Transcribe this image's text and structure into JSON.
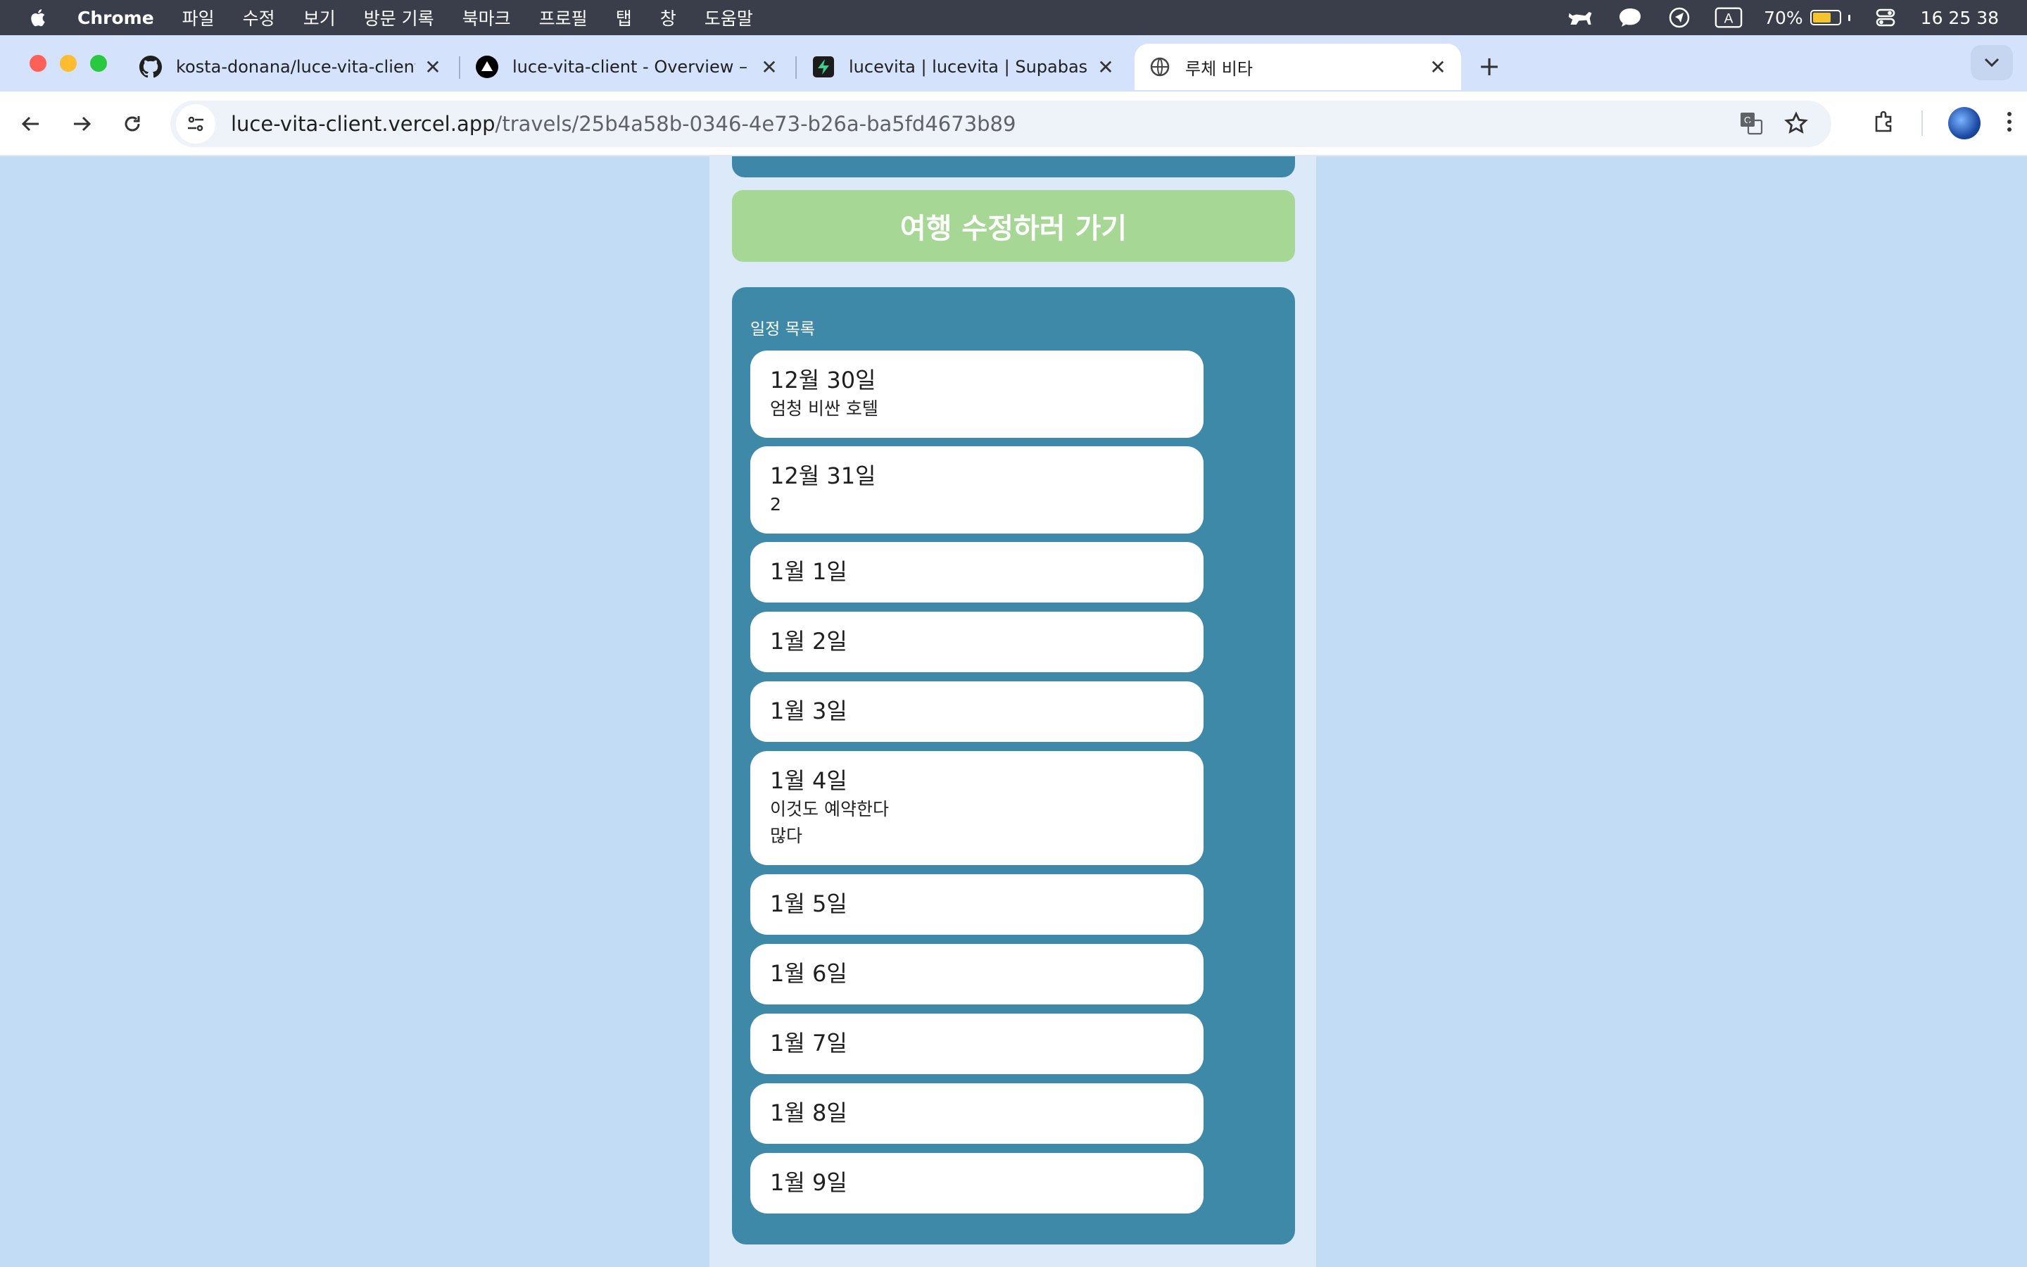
{
  "menubar": {
    "app_name": "Chrome",
    "items": [
      "파일",
      "수정",
      "보기",
      "방문 기록",
      "북마크",
      "프로필",
      "탭",
      "창",
      "도움말"
    ],
    "battery_percent": "70%",
    "time": "16 25 38"
  },
  "tabs": [
    {
      "title": "kosta-donana/luce-vita-client",
      "icon": "github-icon",
      "active": false
    },
    {
      "title": "luce-vita-client - Overview – ",
      "icon": "vercel-icon",
      "active": false
    },
    {
      "title": "lucevita | lucevita | Supabase",
      "icon": "supabase-icon",
      "active": false
    },
    {
      "title": "루체 비타",
      "icon": "globe-icon",
      "active": true
    }
  ],
  "address_bar": {
    "host": "luce-vita-client.vercel.app",
    "path": "/travels/25b4a58b-0346-4e73-b26a-ba5fd4673b89"
  },
  "page": {
    "edit_button_label": "여행 수정하러 가기",
    "schedule_title": "일정 목록",
    "days": [
      {
        "date": "12월 30일",
        "notes": [
          "엄청 비싼 호텔"
        ]
      },
      {
        "date": "12월 31일",
        "notes": [
          "2"
        ]
      },
      {
        "date": "1월 1일",
        "notes": []
      },
      {
        "date": "1월 2일",
        "notes": []
      },
      {
        "date": "1월 3일",
        "notes": []
      },
      {
        "date": "1월 4일",
        "notes": [
          "이것도 예약한다",
          "많다"
        ]
      },
      {
        "date": "1월 5일",
        "notes": []
      },
      {
        "date": "1월 6일",
        "notes": []
      },
      {
        "date": "1월 7일",
        "notes": []
      },
      {
        "date": "1월 8일",
        "notes": []
      },
      {
        "date": "1월 9일",
        "notes": []
      }
    ]
  },
  "colors": {
    "page_background": "#c2dcf5",
    "column_background": "#dbe9f8",
    "edit_button": "#a6d794",
    "schedule_panel": "#3f89a8",
    "card": "#ffffff"
  }
}
